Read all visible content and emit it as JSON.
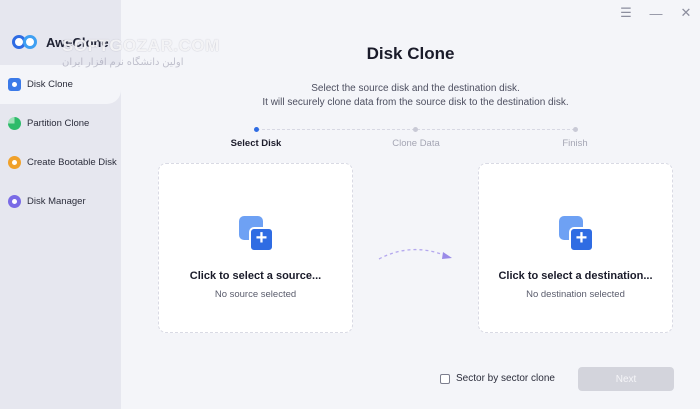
{
  "app": {
    "name": "AweClone"
  },
  "watermark": {
    "line1": "SOFTGOZAR.COM",
    "line2": "اولین دانشگاه نرم افزار ایران"
  },
  "sidebar": {
    "items": [
      {
        "label": "Disk Clone",
        "icon": "disk-clone-icon",
        "active": true
      },
      {
        "label": "Partition Clone",
        "icon": "partition-clone-icon",
        "active": false
      },
      {
        "label": "Create Bootable Disk",
        "icon": "bootable-disk-icon",
        "active": false
      },
      {
        "label": "Disk Manager",
        "icon": "disk-manager-icon",
        "active": false
      }
    ]
  },
  "window": {
    "controls": [
      "menu-icon",
      "minimize-icon",
      "close-icon"
    ]
  },
  "main": {
    "title": "Disk Clone",
    "subtitle_line1": "Select the source disk and the destination disk.",
    "subtitle_line2": "It will securely clone data from the source disk to the destination disk."
  },
  "steps": [
    {
      "label": "Select Disk",
      "active": true
    },
    {
      "label": "Clone Data",
      "active": false
    },
    {
      "label": "Finish",
      "active": false
    }
  ],
  "source": {
    "title": "Click to select a source...",
    "status": "No source selected"
  },
  "destination": {
    "title": "Click to select a destination...",
    "status": "No destination selected"
  },
  "footer": {
    "sector_label": "Sector by sector clone",
    "sector_checked": false,
    "next_label": "Next"
  },
  "colors": {
    "accent": "#2f6ce3",
    "sidebar_bg": "#e6e7ef",
    "main_bg": "#f4f5f9",
    "disabled_btn": "#d3d4dc"
  }
}
